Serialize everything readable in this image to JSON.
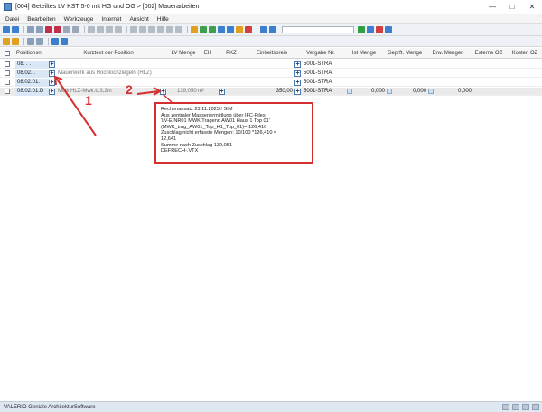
{
  "window": {
    "title": "[004] Geteiltes LV KST 5-0 mit HG und OG > [002] Mauerarbeiten",
    "minimize_glyph": "—",
    "maximize_glyph": "□",
    "close_glyph": "✕"
  },
  "menu": [
    "Datei",
    "Bearbeiten",
    "Werkzeuge",
    "Internet",
    "Ansicht",
    "Hilfe"
  ],
  "table": {
    "columns": [
      "Positionsn.",
      "Kurztext der Position",
      "LV Menge",
      "EH",
      "PKZ",
      "Einheitspreis",
      "Vergabe Nr.",
      "Ist Menge",
      "Geprft. Menge",
      "Erw. Mengen",
      "Externe OZ",
      "Kosten OZ"
    ],
    "rows": [
      {
        "posnr": "08. . .",
        "kurztext": "",
        "lv_menge": "",
        "eh": "",
        "einheitspreis": "",
        "vergabe": "5001-STRA",
        "ist_menge": "",
        "geprueft": "",
        "erw": ""
      },
      {
        "posnr": "08.02. .",
        "kurztext": "Mauerwerk aus Hochlochziegeln (HLZ)",
        "lv_menge": "",
        "eh": "",
        "einheitspreis": "",
        "vergabe": "5001-STRA",
        "ist_menge": "",
        "geprueft": "",
        "erw": ""
      },
      {
        "posnr": "08.02.01.",
        "kurztext": "",
        "lv_menge": "",
        "eh": "",
        "einheitspreis": "",
        "vergabe": "5001-STRA",
        "ist_menge": "",
        "geprueft": "",
        "erw": ""
      },
      {
        "posnr": "08.02.01.D",
        "kurztext": "Mwk HLZ-Mwk.b.3,2m",
        "lv_menge": "139,050",
        "eh": "m²",
        "einheitspreis": "350,00",
        "vergabe": "5001-STRA",
        "ist_menge": "0,000",
        "geprueft": "0,000",
        "erw": "0,000"
      }
    ]
  },
  "popup": {
    "lines": [
      "Rechenansatz 23.11.2023 / SIM",
      "Aus zentraler Massenermittlung über IFC-Files",
      "'LV-EINR01 MWK Tragend AW01 Haus 1 Top 01'",
      "(MWK_trag_AW01_Top_H1_Top_01)= 126,410",
      "Zuschlag nicht erfasste Mengen: 10/100 *126,410 =",
      "12,641",
      "Summe nach Zuschlag 139,051",
      "DEFRECH-.VTX"
    ]
  },
  "annotations": {
    "marker_1": "1",
    "marker_2": "2",
    "color": "#d32f2f"
  },
  "status": {
    "text": "VALERIO Geniale ArchitekturSoftware"
  }
}
